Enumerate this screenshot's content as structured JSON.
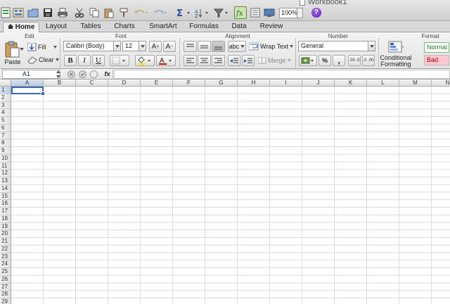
{
  "window": {
    "title": "Workbook1"
  },
  "toolbar": {
    "zoom": "100%",
    "help_label": "?"
  },
  "tabs": [
    {
      "label": "Home",
      "active": true
    },
    {
      "label": "Layout"
    },
    {
      "label": "Tables"
    },
    {
      "label": "Charts"
    },
    {
      "label": "SmartArt"
    },
    {
      "label": "Formulas"
    },
    {
      "label": "Data"
    },
    {
      "label": "Review"
    }
  ],
  "ribbon": {
    "groups": {
      "edit": "Edit",
      "font": "Font",
      "alignment": "Alignment",
      "number": "Number",
      "format": "Format"
    },
    "edit": {
      "paste": "Paste",
      "fill": "Fill",
      "clear": "Clear"
    },
    "font": {
      "name": "Calibri (Body)",
      "size": "12",
      "bold": "B",
      "italic": "I",
      "underline": "U",
      "grow": "A",
      "shrink": "A",
      "font_color_letter": "A"
    },
    "alignment": {
      "orientation": "abc",
      "wrap_text": "Wrap Text",
      "merge": "Merge"
    },
    "number": {
      "format": "General",
      "percent": "%",
      "comma": ",",
      "increase_decimal": ".00 .0",
      "decrease_decimal": ".0 .00"
    },
    "format": {
      "conditional": "Conditional",
      "formatting": "Formatting",
      "style_normal": "Normal",
      "style_bad": "Bad"
    }
  },
  "formula_bar": {
    "name_box": "A1",
    "fx": "fx",
    "formula": ""
  },
  "grid": {
    "columns": [
      "A",
      "B",
      "C",
      "D",
      "E",
      "F",
      "G",
      "H",
      "I",
      "J",
      "K",
      "L",
      "M",
      "N"
    ],
    "rows": [
      "1",
      "2",
      "3",
      "4",
      "5",
      "6",
      "7",
      "8",
      "9",
      "10",
      "11",
      "12",
      "13",
      "14",
      "15",
      "16",
      "17",
      "18",
      "19",
      "20",
      "21",
      "22",
      "23",
      "24",
      "25",
      "26",
      "27",
      "28",
      "29"
    ],
    "active_cell": "A1"
  },
  "colors": {
    "accent": "#3b66b5",
    "style_bad_bg": "#ffc7ce",
    "style_bad_text": "#9c0006",
    "font_color_bar": "#e00000",
    "fill_color_bar": "#f4e400"
  }
}
